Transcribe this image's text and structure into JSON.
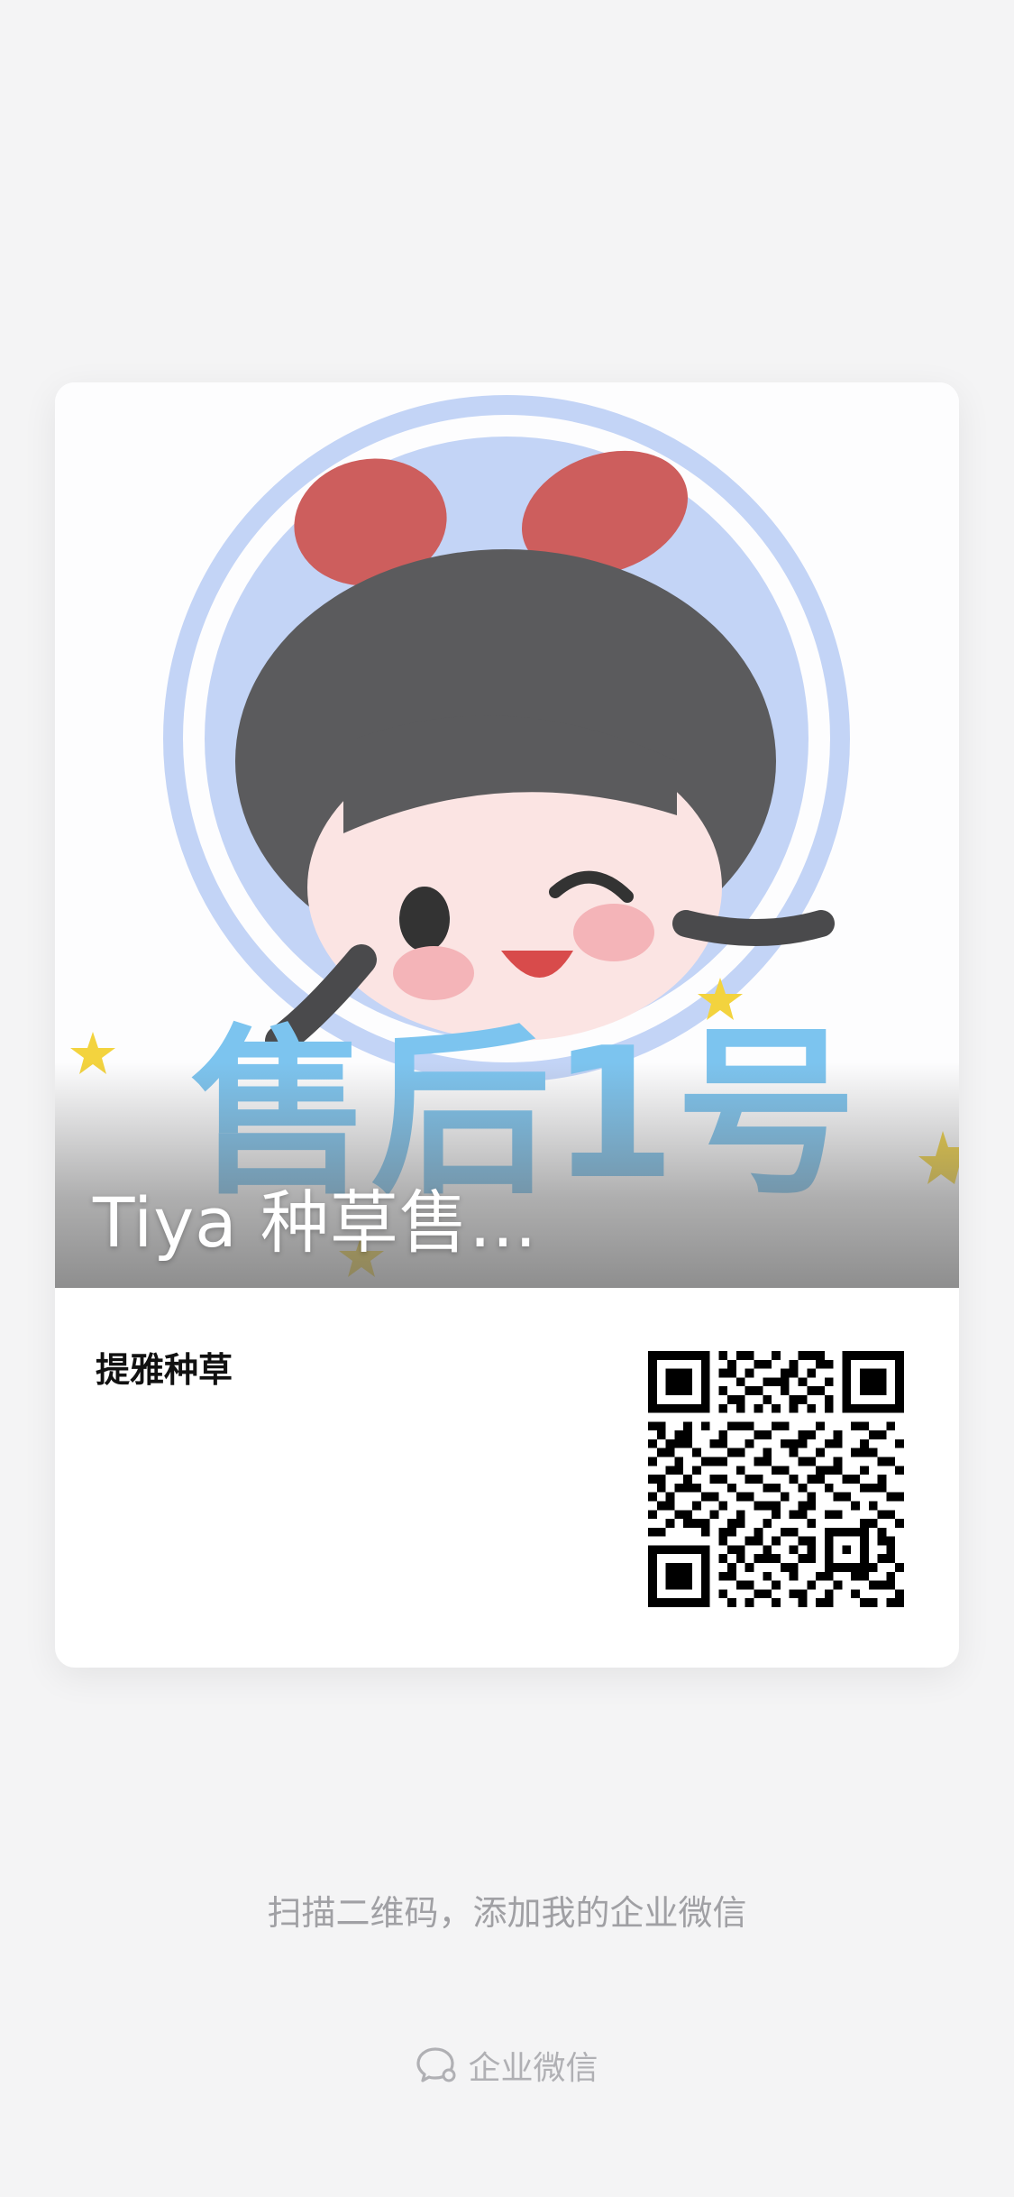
{
  "card": {
    "cover_title": "Tiya 种草售…",
    "cover_badge_text": "售后1号",
    "company_name": "提雅种草"
  },
  "hint_text": "扫描二维码，添加我的企业微信",
  "footer": {
    "brand_label": "企业微信",
    "brand_icon": "wecom-logo-icon"
  },
  "colors": {
    "page_bg": "#f4f4f5",
    "avatar_ring": "#c3d4f6",
    "badge_blue": "#7cc4ef",
    "bow_red": "#d15f5f"
  }
}
